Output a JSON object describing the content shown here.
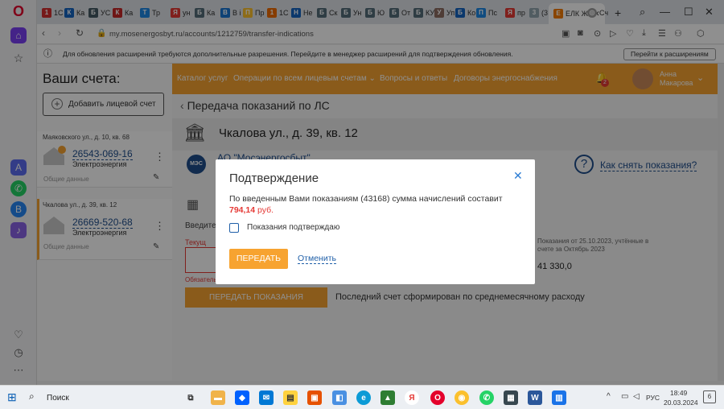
{
  "browser": {
    "tabs": [
      {
        "label": "1С",
        "color": "#d32f2f",
        "glyph": "1"
      },
      {
        "label": "Ка",
        "color": "#1565c0",
        "glyph": "К"
      },
      {
        "label": "УС",
        "color": "#455a64",
        "glyph": "Б"
      },
      {
        "label": "Ка",
        "color": "#c62828",
        "glyph": "К"
      },
      {
        "label": "Тр",
        "color": "#1e88e5",
        "glyph": "Т"
      },
      {
        "label": "ун",
        "color": "#e53935",
        "glyph": "Я"
      },
      {
        "label": "Ка",
        "color": "#546e7a",
        "glyph": "Б"
      },
      {
        "label": "В і",
        "color": "#1976d2",
        "glyph": "В"
      },
      {
        "label": "Пр",
        "color": "#fbc02d",
        "glyph": "П"
      },
      {
        "label": "1С",
        "color": "#ef6c00",
        "glyph": "1"
      },
      {
        "label": "Не",
        "color": "#1565c0",
        "glyph": "Н"
      },
      {
        "label": "Ск",
        "color": "#546e7a",
        "glyph": "Б"
      },
      {
        "label": "Ун",
        "color": "#546e7a",
        "glyph": "Б"
      },
      {
        "label": "Ю",
        "color": "#546e7a",
        "glyph": "Б"
      },
      {
        "label": "От",
        "color": "#546e7a",
        "glyph": "Б"
      },
      {
        "label": "КУ",
        "color": "#546e7a",
        "glyph": "Б"
      },
      {
        "label": "Уп",
        "color": "#8d6e63",
        "glyph": "У"
      },
      {
        "label": "Ко",
        "color": "#1565c0",
        "glyph": "Б"
      },
      {
        "label": "Пс",
        "color": "#1e88e5",
        "glyph": "П"
      },
      {
        "label": "пр",
        "color": "#e53935",
        "glyph": "Я"
      },
      {
        "label": "(3",
        "color": "#90a4ae",
        "glyph": "3"
      }
    ],
    "active_tab": "ЕЛК Ж",
    "other_tab": "Сч",
    "new_tab_symbol": "+",
    "url": "my.mosenergosbyt.ru/accounts/1212759/transfer-indications",
    "notification_text": "Для обновления расширений требуются дополнительные разрешения. Перейдите в менеджер расширений для подтверждения обновления.",
    "notification_button": "Перейти к расширениям"
  },
  "sidebar": {
    "title": "Ваши счета:",
    "add_account": "Добавить лицевой счет",
    "accounts": [
      {
        "address": "Маяковского ул., д. 10, кв. 68",
        "number": "26543-069-16",
        "type": "Электроэнергия",
        "note": "Общие данные"
      },
      {
        "address": "Чкалова ул., д. 39, кв. 12",
        "number": "26669-520-68",
        "type": "Электроэнергия",
        "note": "Общие данные"
      }
    ]
  },
  "topnav": {
    "items": [
      "Каталог услуг",
      "Операции по всем лицевым счетам",
      "Вопросы и ответы",
      "Договоры энергоснабжения"
    ],
    "notif_count": "2",
    "user_first": "Анна",
    "user_last": "Макарова"
  },
  "main": {
    "back_title": "Передача показаний по ЛС",
    "address": "Чкалова ул., д. 39, кв. 12",
    "provider": "АО \"Мосэнергосбыт\"",
    "provider_logo": "МЭС",
    "help_link": "Как снять показания?",
    "enter_label": "Введите",
    "current_label": "Текущ",
    "required_label": "Обязатель",
    "previous_note": "Показания от 25.10.2023, учтённые в счете за Октябрь 2023",
    "previous_value": "41 330,0",
    "submit_button": "ПЕРЕДАТЬ ПОКАЗАНИЯ",
    "last_bill_note": "Последний счет сформирован по среднемесячному расходу"
  },
  "modal": {
    "title": "Подтверждение",
    "message": "По введенным Вами показаниям (43168) сумма начислений составит",
    "amount": "794,14",
    "currency": "руб.",
    "checkbox_label": "Показания подтверждаю",
    "checkbox_checked": false,
    "confirm_button": "ПЕРЕДАТЬ",
    "cancel_link": "Отменить",
    "accent": "#f7a330",
    "amount_color": "#e53935"
  },
  "taskbar": {
    "search_label": "Поиск",
    "language": "РУС",
    "time": "18:49",
    "date": "20.03.2024",
    "notif_count": "6"
  }
}
